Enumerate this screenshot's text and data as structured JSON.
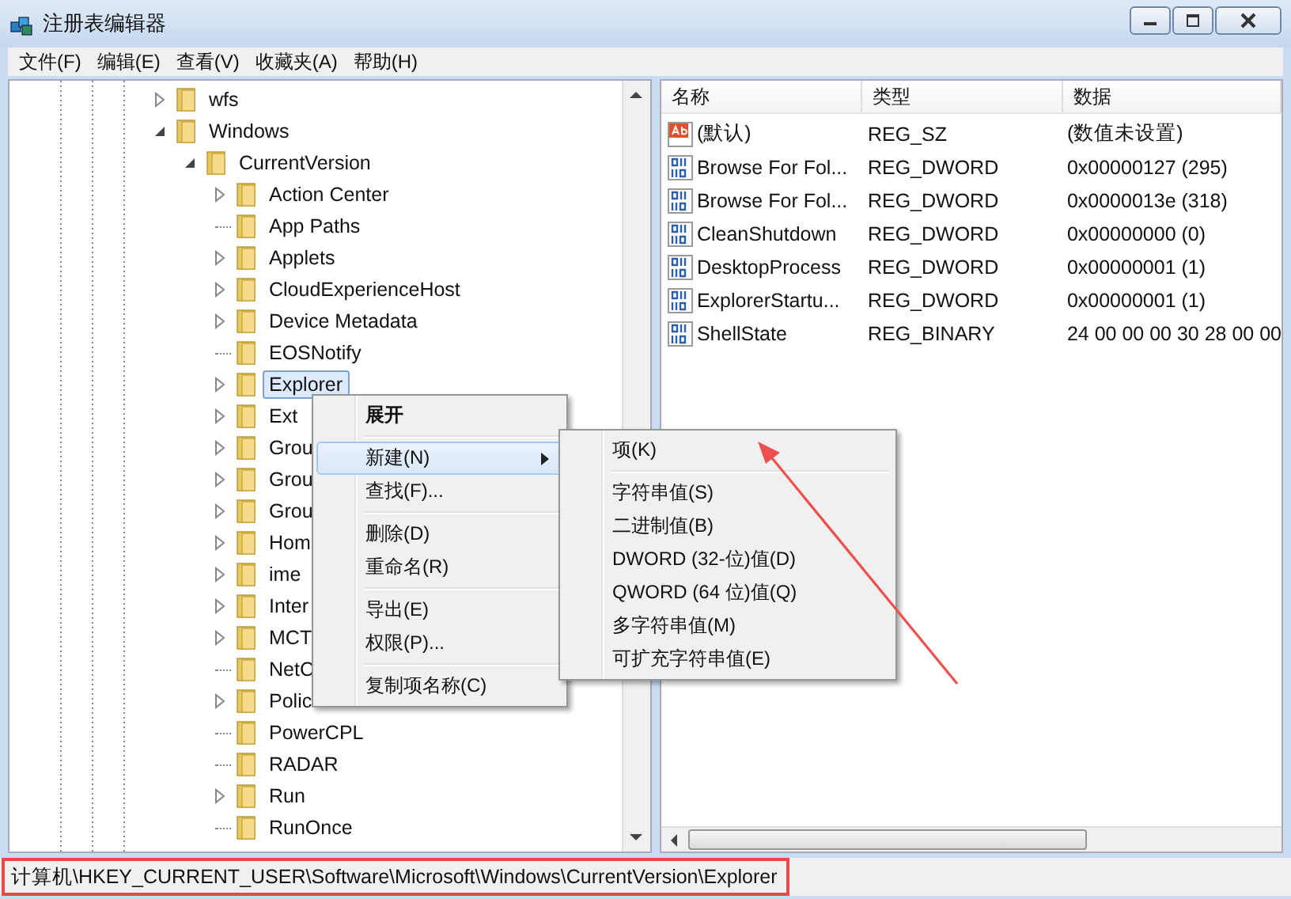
{
  "window": {
    "title": "注册表编辑器"
  },
  "menu_bar": [
    "文件(F)",
    "编辑(E)",
    "查看(V)",
    "收藏夹(A)",
    "帮助(H)"
  ],
  "tree": [
    {
      "label": "wfs",
      "expanded": false,
      "selected": false
    },
    {
      "label": "Windows",
      "expanded": true,
      "selected": false,
      "children": [
        {
          "label": "CurrentVersion",
          "expanded": true,
          "selected": false,
          "children": [
            {
              "label": "Action Center",
              "expanded": false,
              "selected": false
            },
            {
              "label": "App Paths",
              "selected": false
            },
            {
              "label": "Applets",
              "expanded": false,
              "selected": false
            },
            {
              "label": "CloudExperienceHost",
              "expanded": false,
              "selected": false
            },
            {
              "label": "Device Metadata",
              "expanded": false,
              "selected": false
            },
            {
              "label": "EOSNotify",
              "selected": false
            },
            {
              "label": "Explorer",
              "expanded": false,
              "selected": true
            },
            {
              "label": "Ext",
              "expanded": false,
              "selected": false
            },
            {
              "label": "Grou",
              "expanded": false,
              "selected": false
            },
            {
              "label": "Grou",
              "expanded": false,
              "selected": false
            },
            {
              "label": "Grou",
              "expanded": false,
              "selected": false
            },
            {
              "label": "Hom",
              "expanded": false,
              "selected": false
            },
            {
              "label": "ime",
              "expanded": false,
              "selected": false
            },
            {
              "label": "Inter",
              "expanded": false,
              "selected": false
            },
            {
              "label": "MCT",
              "expanded": false,
              "selected": false
            },
            {
              "label": "NetC",
              "selected": false
            },
            {
              "label": "Polic",
              "expanded": false,
              "selected": false
            },
            {
              "label": "PowerCPL",
              "selected": false
            },
            {
              "label": "RADAR",
              "selected": false
            },
            {
              "label": "Run",
              "expanded": false,
              "selected": false
            },
            {
              "label": "RunOnce",
              "selected": false
            }
          ]
        }
      ]
    }
  ],
  "values_table": {
    "columns": [
      "名称",
      "类型",
      "数据"
    ],
    "rows": [
      {
        "kind": "string",
        "name": "(默认)",
        "type": "REG_SZ",
        "data": "(数值未设置)"
      },
      {
        "kind": "binary",
        "name": "Browse For Fol...",
        "type": "REG_DWORD",
        "data": "0x00000127 (295)"
      },
      {
        "kind": "binary",
        "name": "Browse For Fol...",
        "type": "REG_DWORD",
        "data": "0x0000013e (318)"
      },
      {
        "kind": "binary",
        "name": "CleanShutdown",
        "type": "REG_DWORD",
        "data": "0x00000000 (0)"
      },
      {
        "kind": "binary",
        "name": "DesktopProcess",
        "type": "REG_DWORD",
        "data": "0x00000001 (1)"
      },
      {
        "kind": "binary",
        "name": "ExplorerStartu...",
        "type": "REG_DWORD",
        "data": "0x00000001 (1)"
      },
      {
        "kind": "binary",
        "name": "ShellState",
        "type": "REG_BINARY",
        "data": "24 00 00 00 30 28 00 00"
      }
    ]
  },
  "context_menu": {
    "sections": [
      [
        {
          "label": "展开",
          "default": true,
          "selected": false,
          "submenu": false
        }
      ],
      [
        {
          "label": "新建(N)",
          "default": false,
          "selected": true,
          "submenu": true
        },
        {
          "label": "查找(F)...",
          "default": false,
          "selected": false,
          "submenu": false
        }
      ],
      [
        {
          "label": "删除(D)",
          "default": false,
          "selected": false,
          "submenu": false
        },
        {
          "label": "重命名(R)",
          "default": false,
          "selected": false,
          "submenu": false
        }
      ],
      [
        {
          "label": "导出(E)",
          "default": false,
          "selected": false,
          "submenu": false
        },
        {
          "label": "权限(P)...",
          "default": false,
          "selected": false,
          "submenu": false
        }
      ],
      [
        {
          "label": "复制项名称(C)",
          "default": false,
          "selected": false,
          "submenu": false
        }
      ]
    ]
  },
  "submenu": {
    "sections": [
      [
        "项(K)"
      ],
      [
        "字符串值(S)",
        "二进制值(B)",
        "DWORD (32-位)值(D)",
        "QWORD (64 位)值(Q)",
        "多字符串值(M)",
        "可扩充字符串值(E)"
      ]
    ]
  },
  "status_bar": "计算机\\HKEY_CURRENT_USER\\Software\\Microsoft\\Windows\\CurrentVersion\\Explorer"
}
